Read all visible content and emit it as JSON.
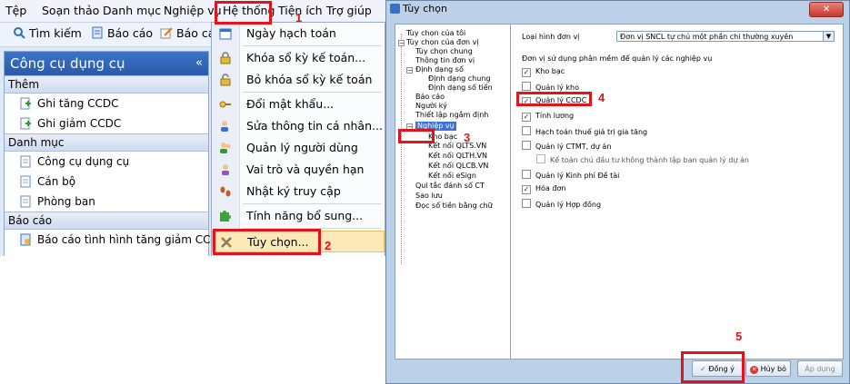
{
  "menu": {
    "items": [
      "Tệp",
      "Soạn thảo",
      "Danh mục",
      "Nghiệp vụ",
      "Hệ thống",
      "Tiện ích",
      "Trợ giúp"
    ]
  },
  "toolbar": {
    "search_label": "Tìm kiếm",
    "report_label": "Báo cáo",
    "report2_label": "Báo các"
  },
  "sidebar": {
    "title": "Công cụ dụng cụ",
    "collapse_glyph": "«",
    "sections": [
      {
        "header": "Thêm",
        "items": [
          "Ghi tăng CCDC",
          "Ghi giảm CCDC"
        ]
      },
      {
        "header": "Danh mục",
        "items": [
          "Công cụ dụng cụ",
          "Cán bộ",
          "Phòng ban"
        ]
      },
      {
        "header": "Báo cáo",
        "items": [
          "Báo cáo tình hình tăng giảm CCDC"
        ]
      }
    ]
  },
  "system_menu": {
    "items": [
      "Ngày hạch toán",
      "Khóa sổ kỳ kế toán...",
      "Bỏ khóa sổ kỳ kế toán",
      "Đổi mật khẩu...",
      "Sửa thông tin cá nhân...",
      "Quản lý người dùng",
      "Vai trò và quyền hạn",
      "Nhật ký truy cập",
      "Tính năng bổ sung...",
      "Tùy chọn..."
    ]
  },
  "annotations": [
    "1",
    "2",
    "3",
    "4",
    "5"
  ],
  "dialog": {
    "title": "Tùy chọn",
    "close_glyph": "✕",
    "tree": {
      "nodes": [
        "Tùy chọn của tôi",
        "Tùy chọn của đơn vị",
        "Tùy chọn chung",
        "Thông tin đơn vị",
        "Định dạng số",
        "Định dạng chung",
        "Định dạng số tiền",
        "Báo cáo",
        "Người ký",
        "Thiết lập ngầm định",
        "Nghiệp vụ",
        "Kho bạc",
        "Kết nối QLTS.VN",
        "Kết nối QLTH.VN",
        "Kết nối QLCB.VN",
        "Kết nối eSign",
        "Qui tắc đánh số CT",
        "Sao lưu",
        "Đọc số tiền bằng chữ"
      ]
    },
    "right": {
      "unit_type_label": "Loại hình đơn vị",
      "unit_type_value": "Đơn vị SNCL tự chủ một phần chi thường xuyên",
      "modules_label": "Đơn vị sử dụng phân mềm để quản lý các nghiệp vụ",
      "checkboxes": [
        {
          "label": "Kho bạc",
          "checked": true
        },
        {
          "label": "Quản lý kho",
          "checked": false
        },
        {
          "label": "Quản lý CCDC",
          "checked": true
        },
        {
          "label": "Tính lương",
          "checked": true
        },
        {
          "label": "Hạch toán thuế giá trị gia tăng",
          "checked": false
        },
        {
          "label": "Quản lý CTMT, dự án",
          "checked": false
        },
        {
          "label": "Kế toán chủ đầu tư không thành lập ban quản lý dự án",
          "checked": false
        },
        {
          "label": "Quản lý Kinh phí Đề tài",
          "checked": false
        },
        {
          "label": "Hóa đơn",
          "checked": true
        },
        {
          "label": "Quản lý Hợp đồng",
          "checked": false
        }
      ]
    },
    "buttons": {
      "ok": "Đồng ý",
      "cancel": "Hủy bỏ",
      "apply": "Áp dụng"
    }
  },
  "colors": {
    "annotation": "#e3121b",
    "panel_header": "#2a5aa8",
    "menu_highlight": "#fbe9b7"
  }
}
